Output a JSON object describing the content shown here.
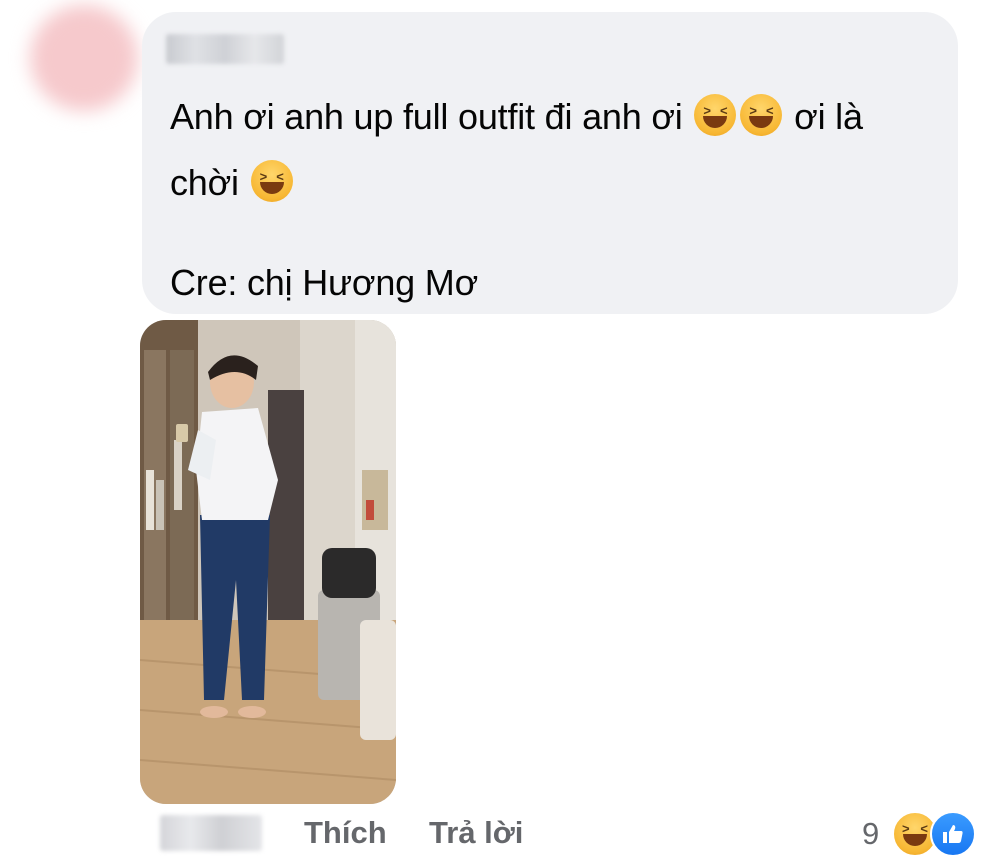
{
  "comment": {
    "line1_before": "Anh ơi anh up full outfit đi anh ơi",
    "line1_after": "ơi là",
    "line2_before": "chời",
    "line3": "Cre: chị Hương Mơ",
    "emoji_icon": "grinning-squinting-face-icon"
  },
  "actions": {
    "like_label": "Thích",
    "reply_label": "Trả lời"
  },
  "reactions": {
    "count": "9",
    "icons": [
      "haha-reaction-icon",
      "like-reaction-icon"
    ],
    "like_color": "#1877f2"
  },
  "colors": {
    "bubble": "#f0f1f4",
    "text": "#050505",
    "secondary_text": "#65676b"
  }
}
